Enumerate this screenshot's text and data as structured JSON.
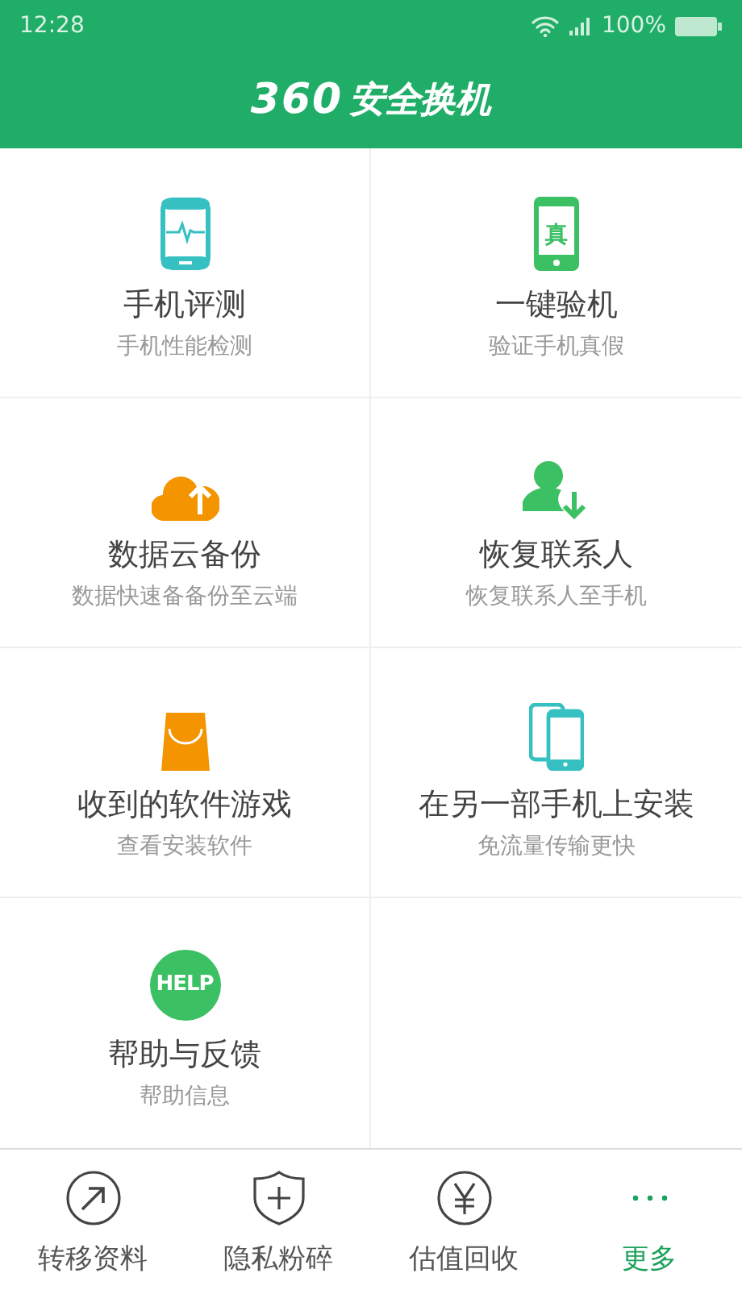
{
  "status_bar": {
    "time": "12:28",
    "battery": "100%"
  },
  "header": {
    "brand": "360",
    "title": "安全换机"
  },
  "icon_labels": [
    "真",
    "HELP"
  ],
  "tiles": [
    {
      "kind": "phone-pulse",
      "title": "手机评测",
      "subtitle": "手机性能检测"
    },
    {
      "kind": "phone-mark",
      "title": "一键验机",
      "subtitle": "验证手机真假"
    },
    {
      "kind": "cloud-upload",
      "title": "数据云备份",
      "subtitle": "数据快速备备份至云端"
    },
    {
      "kind": "contact-download",
      "title": "恢复联系人",
      "subtitle": "恢复联系人至手机"
    },
    {
      "kind": "bag",
      "title": "收到的软件游戏",
      "subtitle": "查看安装软件"
    },
    {
      "kind": "two-phones",
      "title": "在另一部手机上安装",
      "subtitle": "免流量传输更快"
    },
    {
      "kind": "help-circle",
      "title": "帮助与反馈",
      "subtitle": "帮助信息"
    }
  ],
  "bottom_nav": [
    {
      "kind": "arrow-circle",
      "label": "转移资料",
      "selected": false
    },
    {
      "kind": "shield",
      "label": "隐私粉碎",
      "selected": false
    },
    {
      "kind": "yen-circle",
      "label": "估值回收",
      "selected": false
    },
    {
      "kind": "dots",
      "label": "更多",
      "selected": true
    }
  ]
}
